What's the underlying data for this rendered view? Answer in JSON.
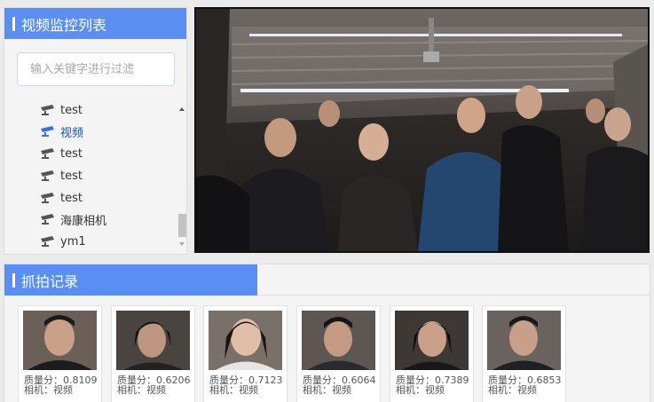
{
  "device_panel": {
    "title": "视频监控列表",
    "search_placeholder": "输入关键字进行过滤",
    "items": [
      {
        "label": "test"
      },
      {
        "label": "视频"
      },
      {
        "label": "test"
      },
      {
        "label": "test"
      },
      {
        "label": "test"
      },
      {
        "label": "海康相机"
      },
      {
        "label": "ym1"
      }
    ]
  },
  "capture_panel": {
    "title": "抓拍记录",
    "records": [
      {
        "quality": "质量分：0.8109",
        "camera": "相机：视频"
      },
      {
        "quality": "质量分：0.6206",
        "camera": "相机：视频"
      },
      {
        "quality": "质量分：0.7123",
        "camera": "相机：视频"
      },
      {
        "quality": "质量分：0.6064",
        "camera": "相机：视频"
      },
      {
        "quality": "质量分：0.7389",
        "camera": "相机：视频"
      },
      {
        "quality": "质量分：0.6853",
        "camera": "相机：视频"
      }
    ]
  },
  "colors": {
    "header_blue": "#5b8ef2",
    "active_item": "#1f4fb3"
  }
}
